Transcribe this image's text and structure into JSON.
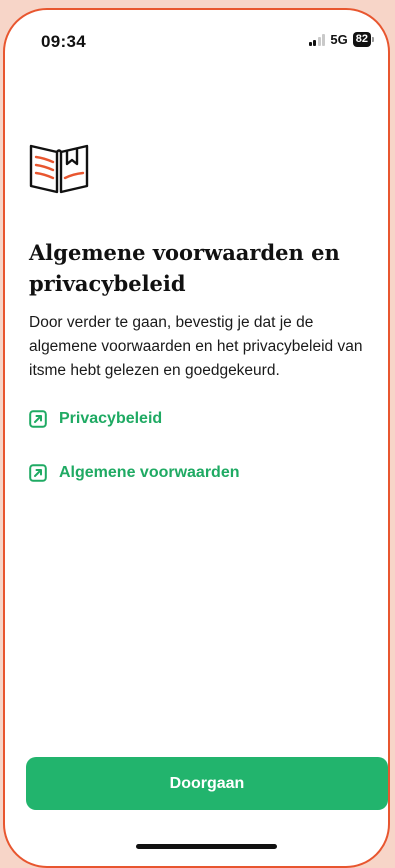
{
  "status_bar": {
    "time": "09:34",
    "network": "5G",
    "battery": "82",
    "signal_icon": "signal-bars-icon",
    "battery_icon": "battery-icon"
  },
  "header_icon": "open-book-icon",
  "title": "Algemene voorwaarden en privacybeleid",
  "body": "Door verder te gaan, bevestig je dat je de algemene voorwaarden en het privacybeleid van itsme hebt gelezen en goedgekeurd.",
  "links": [
    {
      "label": "Privacybeleid",
      "icon": "external-link-icon"
    },
    {
      "label": "Algemene voorwaarden",
      "icon": "external-link-icon"
    }
  ],
  "primary_button": "Doorgaan",
  "colors": {
    "accent": "#22b46d",
    "link": "#1faa63",
    "icon_accent": "#e8562f",
    "frame": "#e8562f"
  }
}
